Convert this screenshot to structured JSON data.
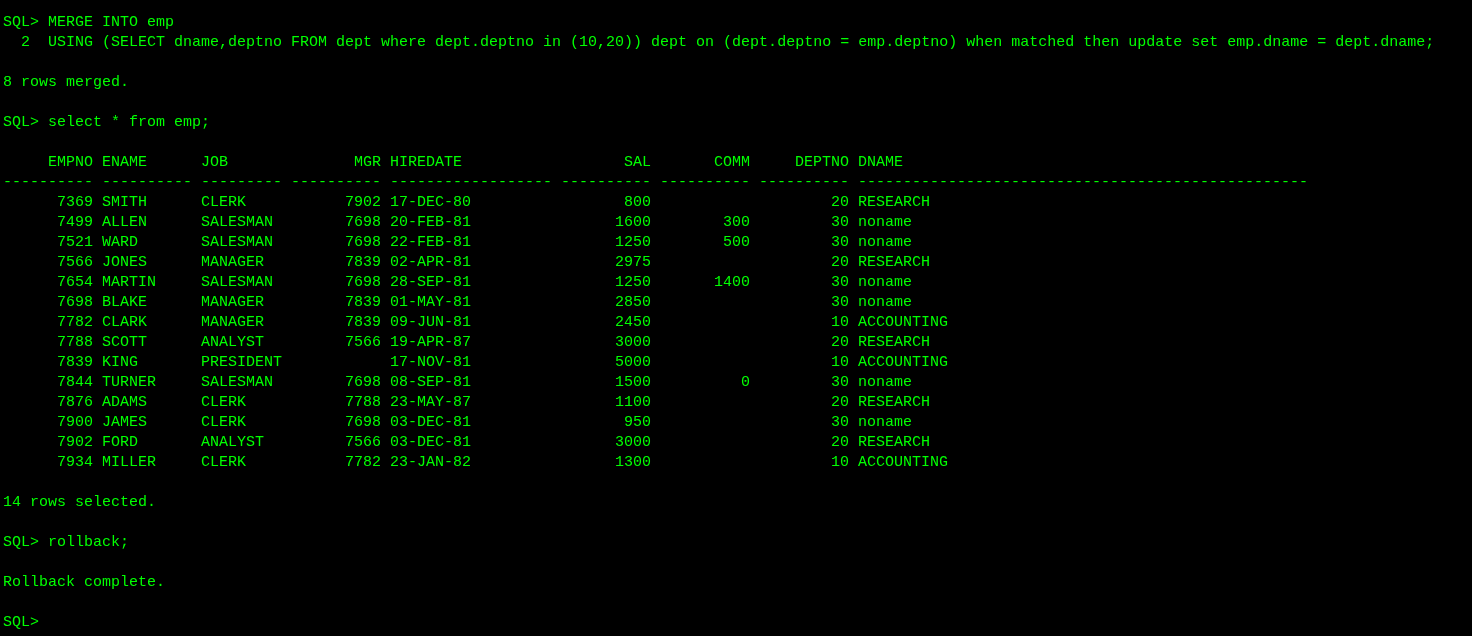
{
  "terminal": {
    "lines": [
      {
        "kind": "text",
        "text": "SQL> MERGE INTO emp"
      },
      {
        "kind": "text",
        "text": "  2  USING (SELECT dname,deptno FROM dept where dept.deptno in (10,20)) dept on (dept.deptno = emp.deptno) when matched then update set emp.dname = dept.dname;"
      },
      {
        "kind": "blank"
      },
      {
        "kind": "text",
        "text": "8 rows merged."
      },
      {
        "kind": "blank"
      },
      {
        "kind": "text",
        "text": "SQL> select * from emp;"
      },
      {
        "kind": "blank"
      },
      {
        "kind": "table",
        "table": {
          "columns": [
            {
              "label": "EMPNO",
              "kind": "number"
            },
            {
              "label": "ENAME",
              "kind": "text"
            },
            {
              "label": "JOB",
              "kind": "text"
            },
            {
              "label": "MGR",
              "kind": "number"
            },
            {
              "label": "HIREDATE",
              "kind": "text"
            },
            {
              "label": "SAL",
              "kind": "number"
            },
            {
              "label": "COMM",
              "kind": "number"
            },
            {
              "label": "DEPTNO",
              "kind": "number"
            },
            {
              "label": "DNAME",
              "kind": "text"
            }
          ],
          "rule": [
            "----------",
            "----------",
            "---------",
            "----------",
            "------------------",
            "----------",
            "----------",
            "----------",
            "--------------------------------------------------"
          ],
          "rows": [
            [
              "7369",
              "SMITH",
              "CLERK",
              "7902",
              "17-DEC-80",
              "800",
              null,
              "20",
              "RESEARCH"
            ],
            [
              "7499",
              "ALLEN",
              "SALESMAN",
              "7698",
              "20-FEB-81",
              "1600",
              "300",
              "30",
              "noname"
            ],
            [
              "7521",
              "WARD",
              "SALESMAN",
              "7698",
              "22-FEB-81",
              "1250",
              "500",
              "30",
              "noname"
            ],
            [
              "7566",
              "JONES",
              "MANAGER",
              "7839",
              "02-APR-81",
              "2975",
              null,
              "20",
              "RESEARCH"
            ],
            [
              "7654",
              "MARTIN",
              "SALESMAN",
              "7698",
              "28-SEP-81",
              "1250",
              "1400",
              "30",
              "noname"
            ],
            [
              "7698",
              "BLAKE",
              "MANAGER",
              "7839",
              "01-MAY-81",
              "2850",
              null,
              "30",
              "noname"
            ],
            [
              "7782",
              "CLARK",
              "MANAGER",
              "7839",
              "09-JUN-81",
              "2450",
              null,
              "10",
              "ACCOUNTING"
            ],
            [
              "7788",
              "SCOTT",
              "ANALYST",
              "7566",
              "19-APR-87",
              "3000",
              null,
              "20",
              "RESEARCH"
            ],
            [
              "7839",
              "KING",
              "PRESIDENT",
              null,
              "17-NOV-81",
              "5000",
              null,
              "10",
              "ACCOUNTING"
            ],
            [
              "7844",
              "TURNER",
              "SALESMAN",
              "7698",
              "08-SEP-81",
              "1500",
              "0",
              "30",
              "noname"
            ],
            [
              "7876",
              "ADAMS",
              "CLERK",
              "7788",
              "23-MAY-87",
              "1100",
              null,
              "20",
              "RESEARCH"
            ],
            [
              "7900",
              "JAMES",
              "CLERK",
              "7698",
              "03-DEC-81",
              "950",
              null,
              "30",
              "noname"
            ],
            [
              "7902",
              "FORD",
              "ANALYST",
              "7566",
              "03-DEC-81",
              "3000",
              null,
              "20",
              "RESEARCH"
            ],
            [
              "7934",
              "MILLER",
              "CLERK",
              "7782",
              "23-JAN-82",
              "1300",
              null,
              "10",
              "ACCOUNTING"
            ]
          ]
        }
      },
      {
        "kind": "blank"
      },
      {
        "kind": "text",
        "text": "14 rows selected."
      },
      {
        "kind": "blank"
      },
      {
        "kind": "text",
        "text": "SQL> rollback;"
      },
      {
        "kind": "blank"
      },
      {
        "kind": "text",
        "text": "Rollback complete."
      },
      {
        "kind": "blank"
      },
      {
        "kind": "text",
        "text": "SQL>"
      }
    ]
  }
}
